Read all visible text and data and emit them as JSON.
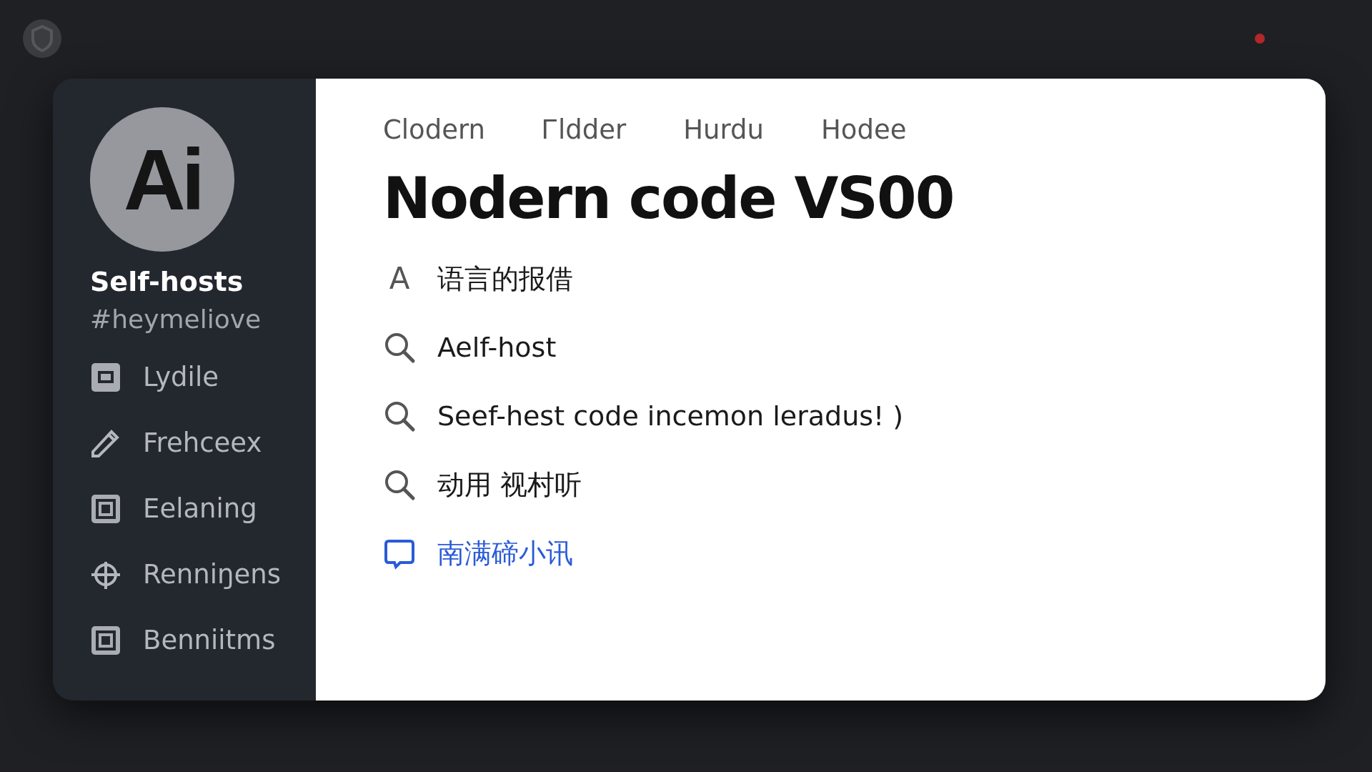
{
  "profile": {
    "avatar": "Ai",
    "name": "Self-hosts",
    "handle": "#heymeliove"
  },
  "sidebar": {
    "items": [
      {
        "label": "Lydile",
        "kind": "square"
      },
      {
        "label": "Frehceex",
        "kind": "pencil"
      },
      {
        "label": "Eelaning",
        "kind": "frame"
      },
      {
        "label": "Renniŋens",
        "kind": "crosshair"
      },
      {
        "label": "Benniitms",
        "kind": "frame"
      }
    ]
  },
  "tabs": [
    "Clodern",
    "Ꮁldder",
    "Hurdu",
    "Hodee"
  ],
  "title": "Nodern code VS00",
  "results": [
    {
      "kind": "letter",
      "glyph": "A",
      "text": "语言的报借"
    },
    {
      "kind": "search",
      "text": "Aelf-host"
    },
    {
      "kind": "search",
      "text": "Seef-hest code incemon leradus! )"
    },
    {
      "kind": "search",
      "text": "动用 视村听"
    },
    {
      "kind": "link",
      "text": "南满碲小讯"
    }
  ]
}
